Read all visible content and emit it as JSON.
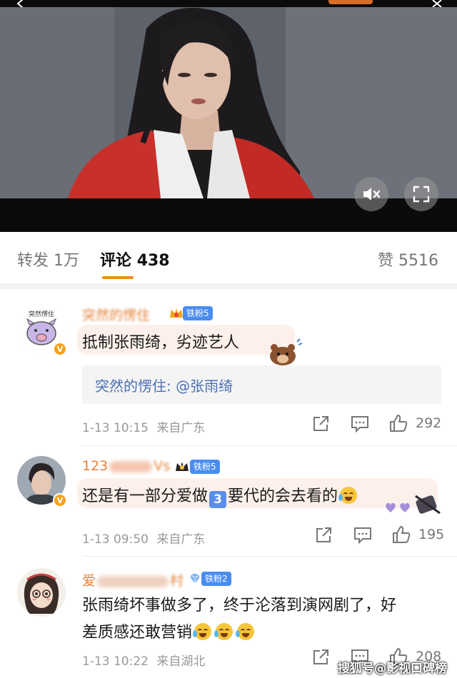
{
  "video": {
    "mute_icon": "speaker-mute-icon",
    "fullscreen_icon": "fullscreen-icon"
  },
  "tabs": {
    "repost_label": "转发",
    "repost_count": "1万",
    "comment_label": "评论",
    "comment_count": "438",
    "like_label": "赞",
    "like_count": "5516",
    "accent": "#f08c14"
  },
  "comments": [
    {
      "user": "突然的愣住",
      "avatar_text": "突然愣住",
      "fan_badge": "铁粉5",
      "text": "抵制张雨绮，劣迹艺人",
      "reply": "突然的愣住: @张雨绮",
      "date": "1-13 10:15",
      "location": "来自广东",
      "likes": "292"
    },
    {
      "user": "123",
      "user_tail": "Vs",
      "fan_badge": "铁粉5",
      "text_before": "还是有一部分爱做",
      "text_badge": "3",
      "text_after": "要代的会去看的",
      "date": "1-13 09:50",
      "location": "来自广东",
      "likes": "195"
    },
    {
      "user": "爱",
      "user_tail": "村",
      "fan_badge": "铁粉2",
      "text_line1": "张雨绮坏事做多了，终于沦落到演网剧了，好",
      "text_line2": "差质感还敢营销",
      "date": "1-13 10:22",
      "location": "来自湖北",
      "likes": "208"
    }
  ],
  "watermark": "搜狐号@影视口碑榜",
  "colors": {
    "username": "#e6813a",
    "link": "#4a6fb5",
    "fan_badge": "#4a8cf0",
    "v_badge": "#f7a21b"
  }
}
